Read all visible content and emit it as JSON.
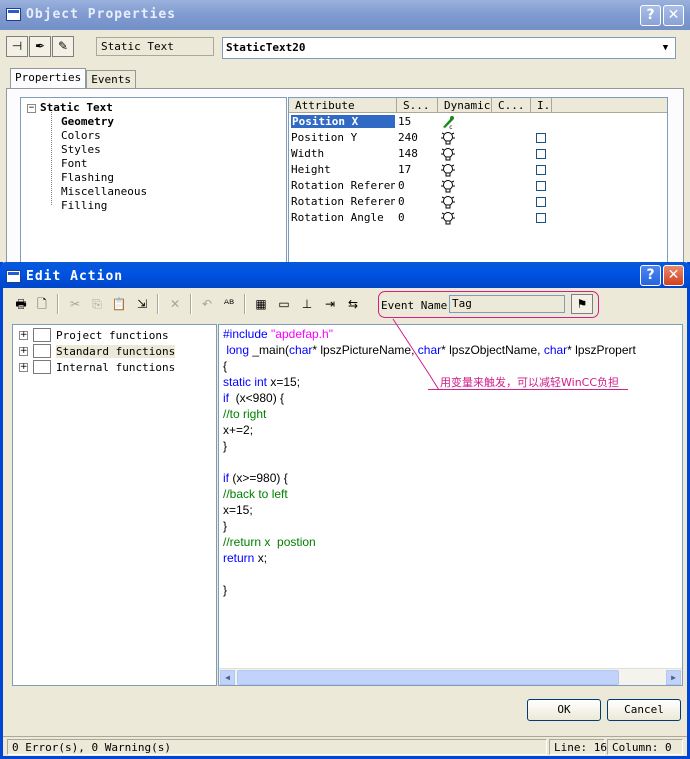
{
  "object_properties": {
    "title": "Object Properties",
    "object_type": "Static Text",
    "object_name": "StaticText20",
    "tabs": [
      "Properties",
      "Events"
    ],
    "tree": {
      "root": "Static Text",
      "items": [
        "Geometry",
        "Colors",
        "Styles",
        "Font",
        "Flashing",
        "Miscellaneous",
        "Filling"
      ],
      "selected": "Geometry"
    },
    "attr_columns": [
      "Attribute",
      "S...",
      "Dynamic",
      "C...",
      "I."
    ],
    "attributes": [
      {
        "name": "Position X",
        "value": "15"
      },
      {
        "name": "Position Y",
        "value": "240"
      },
      {
        "name": "Width",
        "value": "148"
      },
      {
        "name": "Height",
        "value": "17"
      },
      {
        "name": "Rotation Reference",
        "value": "0"
      },
      {
        "name": "Rotation Reference",
        "value": "0"
      },
      {
        "name": "Rotation Angle",
        "value": "0"
      }
    ]
  },
  "edit_action": {
    "title": "Edit Action",
    "event_name_label": "Event Name:",
    "event_name_value": "Tag",
    "function_tree": [
      {
        "label": "Project functions"
      },
      {
        "label": "Standard functions"
      },
      {
        "label": "Internal functions"
      }
    ],
    "code": {
      "l1a": "#include ",
      "l1b": "\"apdefap.h\"",
      "l2a": " long ",
      "l2b": "_main(",
      "l2c": "char",
      "l2d": "* lpszPictureName, ",
      "l2e": "char",
      "l2f": "* lpszObjectName, ",
      "l2g": "char",
      "l2h": "* lpszPropert",
      "l3": "{",
      "l4a": "static int ",
      "l4b": "x=15;",
      "l5a": "if ",
      "l5b": " (x<980) {",
      "l6": "//to right",
      "l7": "x+=2;",
      "l8": "}",
      "l10a": "if ",
      "l10b": "(x>=980) {",
      "l11": "//back to left",
      "l12": "x=15;",
      "l13": "}",
      "l14": "//return x  postion",
      "l15a": "return ",
      "l15b": "x;",
      "l17": "}"
    },
    "annotation": "用变量来触发，可以减轻WinCC负担",
    "ok_label": "OK",
    "cancel_label": "Cancel",
    "status": {
      "errors": "0 Error(s), 0 Warning(s)",
      "line": "Line: 16",
      "column": "Column: 0"
    }
  },
  "colors": {
    "accent_title": "#0054e3",
    "annotation": "#d0208a",
    "keyword": "#0000ff",
    "string": "#ff00ff",
    "comment": "#008000"
  }
}
